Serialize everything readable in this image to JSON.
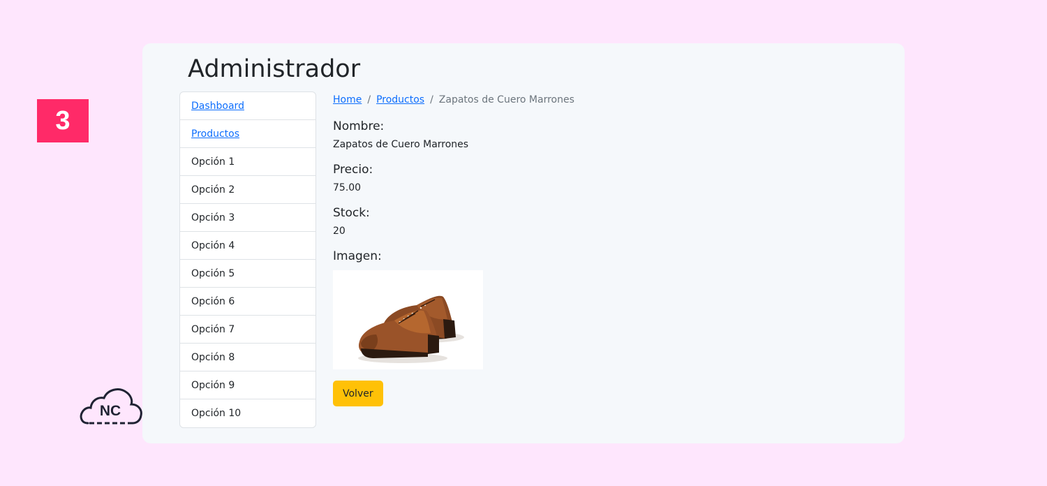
{
  "step_badge": "3",
  "logo_text": "NC",
  "page_title": "Administrador",
  "sidebar": {
    "items": [
      {
        "label": "Dashboard",
        "link": true
      },
      {
        "label": "Productos",
        "link": true
      },
      {
        "label": "Opción 1",
        "link": false
      },
      {
        "label": "Opción 2",
        "link": false
      },
      {
        "label": "Opción 3",
        "link": false
      },
      {
        "label": "Opción 4",
        "link": false
      },
      {
        "label": "Opción 5",
        "link": false
      },
      {
        "label": "Opción 6",
        "link": false
      },
      {
        "label": "Opción 7",
        "link": false
      },
      {
        "label": "Opción 8",
        "link": false
      },
      {
        "label": "Opción 9",
        "link": false
      },
      {
        "label": "Opción 10",
        "link": false
      }
    ]
  },
  "breadcrumb": {
    "home": "Home",
    "separator": "/",
    "products": "Productos",
    "current": "Zapatos de Cuero Marrones"
  },
  "product": {
    "name_label": "Nombre:",
    "name_value": "Zapatos de Cuero Marrones",
    "price_label": "Precio:",
    "price_value": "75.00",
    "stock_label": "Stock:",
    "stock_value": "20",
    "image_label": "Imagen:",
    "image_alt": "brown-leather-brogue-shoes"
  },
  "back_button_label": "Volver",
  "colors": {
    "background": "#fee6fd",
    "card": "#f5f8fb",
    "badge": "#ff2a68",
    "link": "#0d6efd",
    "warning_button": "#ffc107"
  }
}
